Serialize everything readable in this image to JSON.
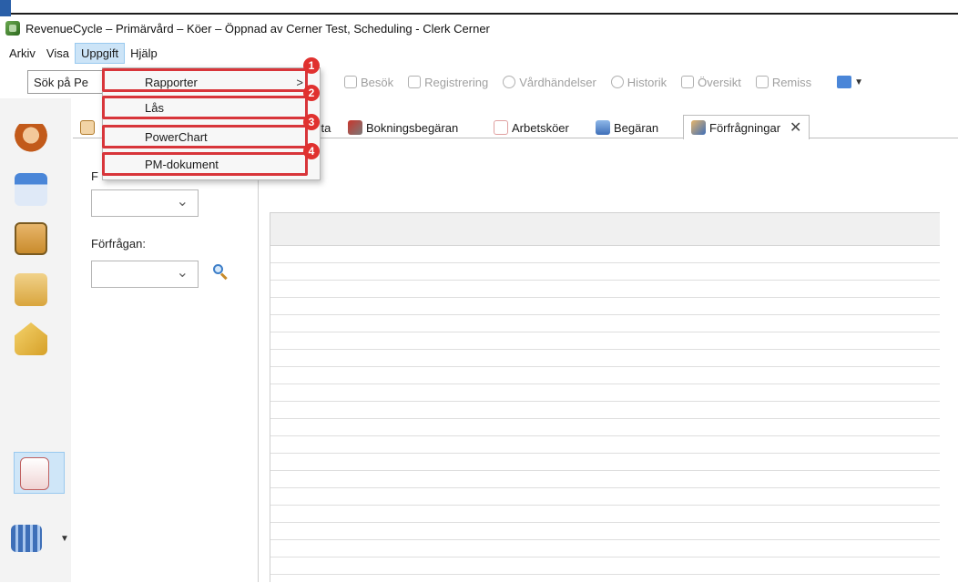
{
  "window": {
    "title": "RevenueCycle – Primärvård – Köer – Öppnad av Cerner Test, Scheduling - Clerk Cerner"
  },
  "menubar": {
    "items": [
      {
        "label": "Arkiv"
      },
      {
        "label": "Visa"
      },
      {
        "label": "Uppgift",
        "active": true
      },
      {
        "label": "Hjälp"
      }
    ]
  },
  "toolbar": {
    "search_value": "Sök på Pe",
    "buttons": [
      {
        "label": "Besök",
        "icon": "visit-icon"
      },
      {
        "label": "Registrering",
        "icon": "registration-icon"
      },
      {
        "label": "Vårdhändelser",
        "icon": "care-events-icon"
      },
      {
        "label": "Historik",
        "icon": "history-icon"
      },
      {
        "label": "Översikt",
        "icon": "overview-icon"
      },
      {
        "label": "Remiss",
        "icon": "referral-icon"
      }
    ]
  },
  "dropdown": {
    "items": [
      {
        "label": "Rapporter",
        "badge": "1",
        "submenu_arrow": ">"
      },
      {
        "label": "Lås",
        "badge": "2"
      },
      {
        "label": "PowerChart",
        "badge": "3"
      },
      {
        "label": "PM-dokument",
        "badge": "4"
      }
    ]
  },
  "tabs": {
    "items": [
      {
        "label": "sta",
        "icon": "list-icon"
      },
      {
        "label": "Bokningsbegäran",
        "icon": "booking-request-icon"
      },
      {
        "label": "Arbetsköer",
        "icon": "work-queue-icon"
      },
      {
        "label": "Begäran",
        "icon": "request-icon"
      },
      {
        "label": "Förfrågningar",
        "icon": "inquiries-icon",
        "active": true
      }
    ],
    "close_glyph": "✕"
  },
  "filter_panel": {
    "first_label_visible": "F",
    "inquiry_label": "Förfrågan:"
  },
  "colors": {
    "highlight": "#d8353a",
    "selection": "#cfe6f8"
  }
}
